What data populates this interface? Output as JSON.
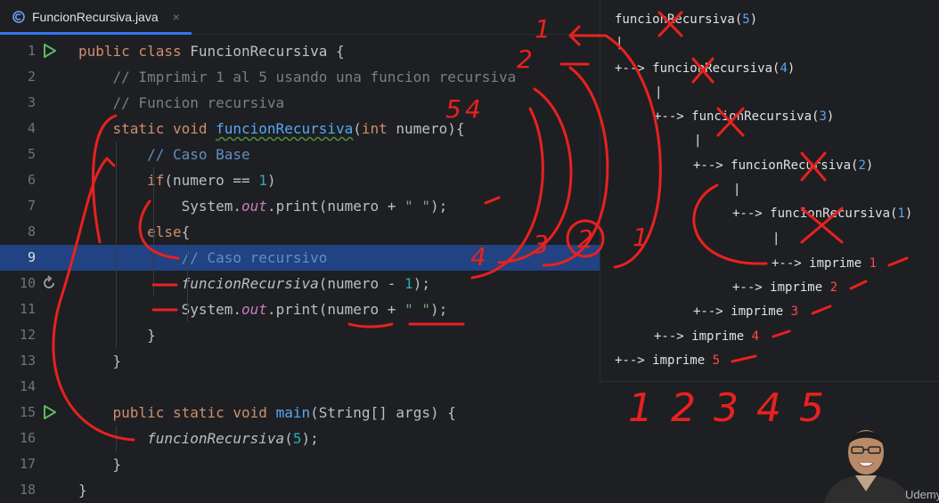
{
  "tab": {
    "title": "FuncionRecursiva.java",
    "close": "×",
    "icon": "java-class-icon"
  },
  "code": {
    "highlight_line": 9,
    "lines": [
      {
        "n": "1",
        "parts": [
          [
            "kw",
            "public class "
          ],
          [
            "cls",
            "FuncionRecursiva"
          ],
          [
            "",
            " {"
          ]
        ]
      },
      {
        "n": "2",
        "parts": [
          [
            "cm",
            "    // Imprimir 1 al 5 usando una funcion recursiva"
          ]
        ]
      },
      {
        "n": "3",
        "parts": [
          [
            "cm",
            "    // Funcion recursiva"
          ]
        ]
      },
      {
        "n": "4",
        "parts": [
          [
            "kw",
            "    static void "
          ],
          [
            "fnw",
            "funcionRecursiva"
          ],
          [
            "",
            "("
          ],
          [
            "kw",
            "int "
          ],
          [
            "",
            "numero){"
          ]
        ]
      },
      {
        "n": "5",
        "parts": [
          [
            "doc",
            "        // Caso Base"
          ]
        ]
      },
      {
        "n": "6",
        "parts": [
          [
            "kw",
            "        if"
          ],
          [
            "",
            "(numero == "
          ],
          [
            "num",
            "1"
          ],
          [
            "",
            ")"
          ]
        ]
      },
      {
        "n": "7",
        "parts": [
          [
            "",
            "            System."
          ],
          [
            "fld",
            "out"
          ],
          [
            "",
            ".print(numero + "
          ],
          [
            "str",
            "\" \""
          ],
          [
            "",
            ");"
          ]
        ]
      },
      {
        "n": "8",
        "parts": [
          [
            "kw",
            "        else"
          ],
          [
            "",
            "{"
          ]
        ]
      },
      {
        "n": "9",
        "parts": [
          [
            "doc",
            "            // Caso recursivo"
          ]
        ]
      },
      {
        "n": "10",
        "parts": [
          [
            "it",
            "            funcionRecursiva"
          ],
          [
            "",
            "(numero - "
          ],
          [
            "num",
            "1"
          ],
          [
            "",
            ");"
          ]
        ]
      },
      {
        "n": "11",
        "parts": [
          [
            "",
            "            System."
          ],
          [
            "fld",
            "out"
          ],
          [
            "",
            ".print(numero + "
          ],
          [
            "str",
            "\" \""
          ],
          [
            "",
            ");"
          ]
        ]
      },
      {
        "n": "12",
        "parts": [
          [
            "",
            "        }"
          ]
        ]
      },
      {
        "n": "13",
        "parts": [
          [
            "",
            "    }"
          ]
        ]
      },
      {
        "n": "14",
        "parts": [
          [
            "",
            ""
          ]
        ]
      },
      {
        "n": "15",
        "parts": [
          [
            "kw",
            "    public static void "
          ],
          [
            "fn",
            "main"
          ],
          [
            "",
            "(String[] args) {"
          ]
        ]
      },
      {
        "n": "16",
        "parts": [
          [
            "it",
            "        funcionRecursiva"
          ],
          [
            "",
            "("
          ],
          [
            "num",
            "5"
          ],
          [
            "",
            ");"
          ]
        ]
      },
      {
        "n": "17",
        "parts": [
          [
            "",
            "    }"
          ]
        ]
      },
      {
        "n": "18",
        "parts": [
          [
            "",
            "}"
          ]
        ]
      }
    ]
  },
  "tree": {
    "lines": [
      {
        "text": "funcionRecursiva(",
        "num": "5",
        "tail": ")"
      },
      {
        "text": "|",
        "num": "",
        "tail": ""
      },
      {
        "text": "+--> funcionRecursiva(",
        "num": "4",
        "tail": ")"
      },
      {
        "text": "|",
        "num": "",
        "tail": ""
      },
      {
        "text": "+--> funcionRecursiva(",
        "num": "3",
        "tail": ")"
      },
      {
        "text": "|",
        "num": "",
        "tail": ""
      },
      {
        "text": "+--> funcionRecursiva(",
        "num": "2",
        "tail": ")"
      },
      {
        "text": "|",
        "num": "",
        "tail": ""
      },
      {
        "text": "+--> funcionRecursiva(",
        "num": "1",
        "tail": ")"
      },
      {
        "text": "|",
        "num": "",
        "tail": ""
      },
      {
        "text": "+--> imprime ",
        "num": "1",
        "tail": ""
      },
      {
        "text": "+--> imprime ",
        "num": "2",
        "tail": ""
      },
      {
        "text": "+--> imprime ",
        "num": "3",
        "tail": ""
      },
      {
        "text": "+--> imprime ",
        "num": "4",
        "tail": ""
      },
      {
        "text": "+--> imprime ",
        "num": "5",
        "tail": ""
      }
    ]
  },
  "annotations": {
    "handwritten_output": [
      "1",
      "2",
      "3",
      "4",
      "5"
    ],
    "call_order_labels": [
      "1",
      "2",
      "5",
      "4"
    ],
    "return_order_labels": [
      "1",
      "2",
      "3",
      "4"
    ],
    "brand": "Udemy",
    "ink_color": "#e8211f"
  }
}
